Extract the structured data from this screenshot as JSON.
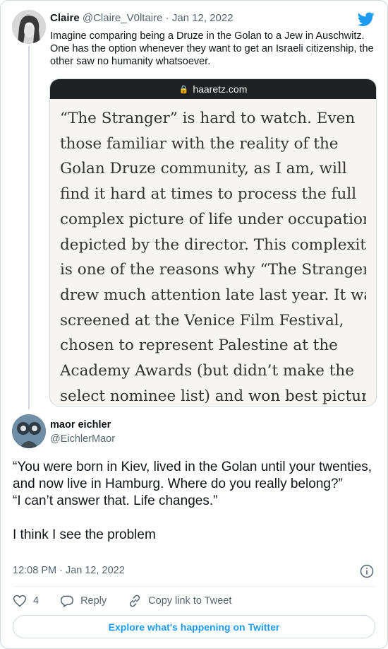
{
  "parent_tweet": {
    "name": "Claire",
    "handle": "@Claire_V0ltaire",
    "date": "Jan 12, 2022",
    "text": "Imagine comparing being a Druze in the Golan to a Jew in Auschwitz. One has the option whenever they want to get an Israeli citizenship, the other saw no humanity whatsoever.",
    "media": {
      "url": "haaretz.com",
      "lines": [
        "“The Stranger” is hard to watch. Even",
        "those familiar with the reality of the",
        "Golan Druze community, as I am, will",
        "find it hard at times to process the full",
        "complex picture of life under occupation",
        "depicted by the director. This complexity",
        "is one of the reasons why “The Stranger”",
        "drew much attention late last year. It was",
        "screened at the Venice Film Festival,",
        "chosen to represent Palestine at the",
        "Academy Awards (but didn’t make the",
        "select nominee list) and won best picture"
      ]
    }
  },
  "main_tweet": {
    "name": "maor eichler",
    "handle": "@EichlerMaor",
    "paragraphs": [
      "“You were born in Kiev, lived in the Golan until your twenties, and now live in Hamburg. Where do you really belong?”",
      "“I can’t answer that. Life changes.”",
      "",
      "I think I see the problem"
    ],
    "timestamp": "12:08 PM · Jan 12, 2022"
  },
  "actions": {
    "like_count": "4",
    "reply_label": "Reply",
    "copy_label": "Copy link to Tweet"
  },
  "explore_label": "Explore what's happening on Twitter",
  "colors": {
    "accent": "#1d9bf0",
    "text": "#0f1419",
    "secondary": "#536471",
    "border": "#cfd9de"
  },
  "icons": [
    "twitter-bird-icon",
    "lock-icon",
    "info-icon",
    "heart-icon",
    "reply-icon",
    "link-icon"
  ]
}
